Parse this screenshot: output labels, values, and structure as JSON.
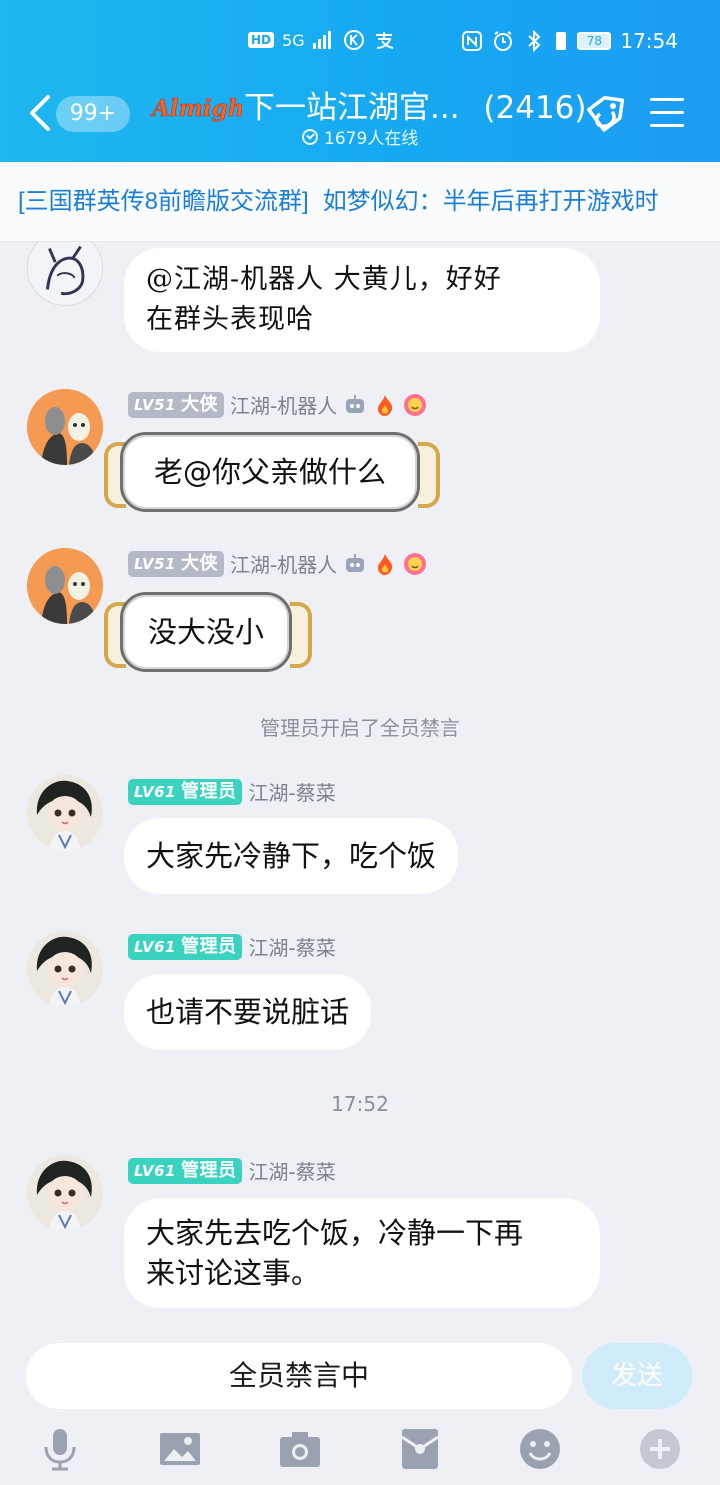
{
  "status_bar": {
    "hd": "HD",
    "network": "5G",
    "battery": "78",
    "time": "17:54"
  },
  "header": {
    "unread_badge": "99+",
    "logo_text": "Almighty",
    "title": "下一站江湖官...",
    "member_count": "(2416)",
    "online": "1679人在线"
  },
  "announcement": {
    "group_name": "[三国群英传8前瞻版交流群]",
    "text": "如梦似幻：半年后再打开游戏时"
  },
  "messages": [
    {
      "level": "LV51",
      "role": "大侠",
      "name": "江湖-机器人",
      "text": "@江湖-机器人 大黄儿，好好在群头表现哈"
    },
    {
      "level": "LV51",
      "role": "大侠",
      "name": "江湖-机器人",
      "text": "老@你父亲做什么"
    },
    {
      "level": "LV51",
      "role": "大侠",
      "name": "江湖-机器人",
      "text": "没大没小"
    },
    {
      "level": "LV61",
      "role": "管理员",
      "name": "江湖-蔡菜",
      "text": "大家先冷静下，吃个饭"
    },
    {
      "level": "LV61",
      "role": "管理员",
      "name": "江湖-蔡菜",
      "text": "也请不要说脏话"
    },
    {
      "level": "LV61",
      "role": "管理员",
      "name": "江湖-蔡菜",
      "text": "大家先去吃个饭，冷静一下再来讨论这事。"
    }
  ],
  "message_first_lines": {
    "m0_line1": "@江湖-机器人 大黄儿，好好",
    "m0_line2": "在群头表现哈",
    "m5_line1": "大家先去吃个饭，冷静一下再",
    "m5_line2": "来讨论这事。"
  },
  "system_notices": {
    "mute_all": "管理员开启了全员禁言",
    "timestamp": "17:52"
  },
  "input": {
    "muted_text": "全员禁言中",
    "send_label": "发送"
  },
  "toolbar_icons": [
    "microphone-icon",
    "image-icon",
    "camera-icon",
    "red-packet-icon",
    "emoji-icon",
    "plus-icon"
  ],
  "colors": {
    "header": "#16a9f2",
    "announcement_link": "#1b7fd9",
    "admin_badge": "#39d3c0",
    "hero_badge": "#b3b9c6",
    "send_disabled": "#d0ecfb"
  }
}
